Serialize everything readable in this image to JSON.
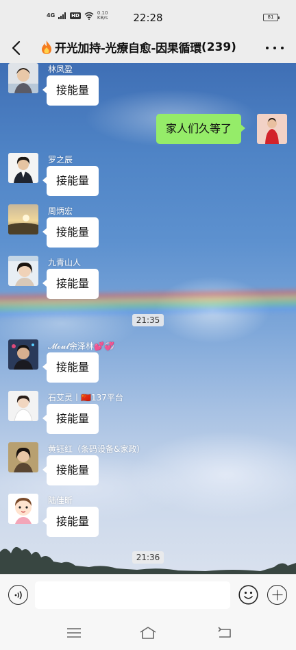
{
  "status_bar": {
    "network": "4G",
    "hd": "HD",
    "speed_value": "0.10",
    "speed_unit": "KB/s",
    "time": "22:28",
    "battery": "81"
  },
  "header": {
    "title": "开光加持-光療自愈-因果循環",
    "member_count": "(239)"
  },
  "messages": [
    {
      "sender": "林凤盈",
      "text": "接能量"
    },
    {
      "sender": "",
      "text": "家人们久等了"
    },
    {
      "sender": "罗之辰",
      "text": "接能量"
    },
    {
      "sender": "周炳宏",
      "text": "接能量"
    },
    {
      "sender": "九青山人",
      "text": "接能量"
    },
    {
      "sender": "𝓜𝓸𝓾𝓵余泽林💕💞",
      "text": "接能量"
    },
    {
      "sender": "石艾灵丨🇨🇳137平台",
      "text": "接能量"
    },
    {
      "sender": "黄钰红（条码设备&家政）",
      "text": "接能量"
    },
    {
      "sender": "陆佳昕",
      "text": "接能量"
    }
  ],
  "timestamps": [
    "21:35",
    "21:36"
  ],
  "colors": {
    "outgoing_bubble": "#95ec69",
    "incoming_bubble": "#ffffff",
    "bar_background": "#ededed"
  }
}
